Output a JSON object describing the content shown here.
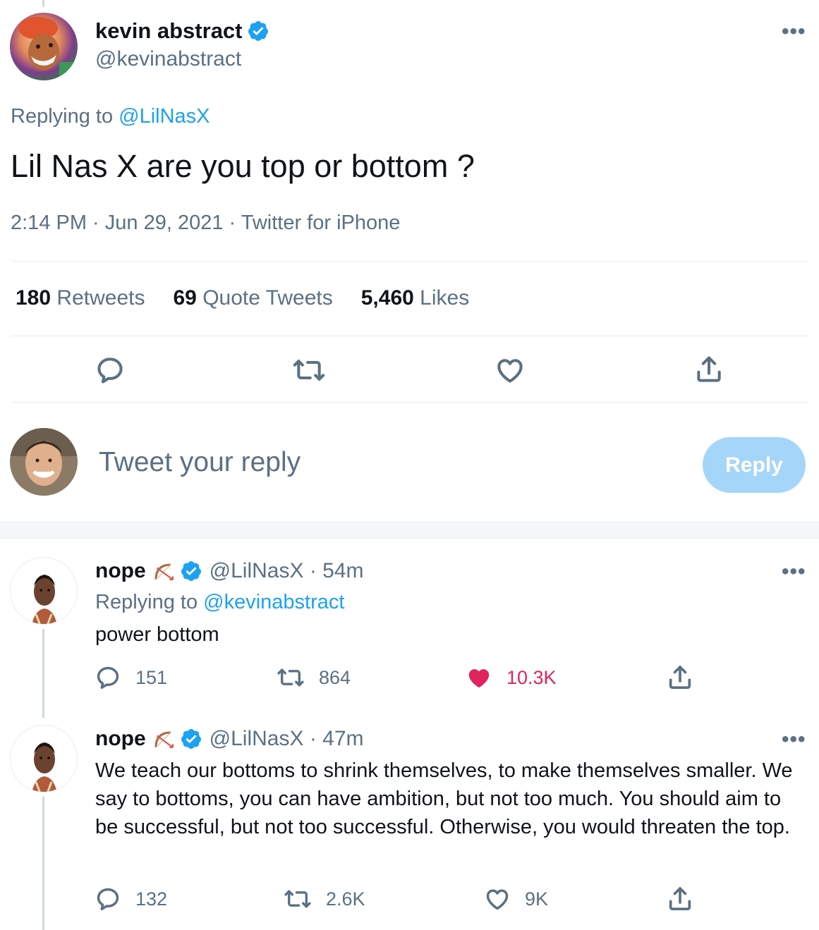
{
  "main_tweet": {
    "author_name": "kevin abstract",
    "author_handle": "@kevinabstract",
    "more_label": "•••",
    "replying_prefix": "Replying to",
    "replying_handle": "@LilNasX",
    "text": "Lil Nas X are you top or bottom ?",
    "meta": "2:14 PM · Jun 29, 2021 · Twitter for iPhone",
    "stats": [
      {
        "count": "180",
        "label": "Retweets"
      },
      {
        "count": "69",
        "label": "Quote Tweets"
      },
      {
        "count": "5,460",
        "label": "Likes"
      }
    ],
    "actions": [
      "reply-icon",
      "retweet-icon",
      "like-icon",
      "share-icon"
    ]
  },
  "compose": {
    "placeholder": "Tweet your reply",
    "button_label": "Reply"
  },
  "replies": [
    {
      "name": "nope",
      "handle_time": "@LilNasX · 54m",
      "replying_prefix": "Replying to",
      "replying_handle": "@kevinabstract",
      "text": "power bottom",
      "reply_count": "151",
      "retweet_count": "864",
      "like_count": "10.3K",
      "liked": true
    },
    {
      "name": "nope",
      "handle_time": "@LilNasX · 47m",
      "text": "We teach our bottoms to shrink themselves, to make themselves smaller. We say to bottoms, you can have ambition, but not too much. You should aim to be successful, but not too successful. Otherwise, you would threaten the top.",
      "reply_count": "132",
      "retweet_count": "2.6K",
      "like_count": "9K",
      "liked": false
    }
  ],
  "colors": {
    "accent": "#1da1f2",
    "secondary_text": "#5b7083",
    "liked": "#e0245e",
    "reply_button_disabled": "#a5d6f9"
  }
}
